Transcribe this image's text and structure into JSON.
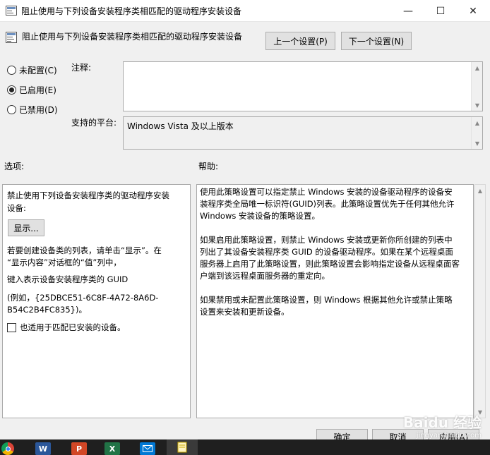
{
  "window": {
    "title": "阻止使用与下列设备安装程序类相匹配的驱动程序安装设备",
    "minimize": "—",
    "maximize": "☐",
    "close": "✕"
  },
  "header": {
    "policy_title": "阻止使用与下列设备安装程序类相匹配的驱动程序安装设备",
    "prev_button": "上一个设置(P)",
    "next_button": "下一个设置(N)"
  },
  "state": {
    "options": [
      {
        "label": "未配置(C)",
        "selected": false
      },
      {
        "label": "已启用(E)",
        "selected": true
      },
      {
        "label": "已禁用(D)",
        "selected": false
      }
    ]
  },
  "comment": {
    "label": "注释:",
    "value": ""
  },
  "platform": {
    "label": "支持的平台:",
    "value": "Windows Vista 及以上版本"
  },
  "options_section": {
    "label": "选项:",
    "line1": "禁止使用下列设备安装程序类的驱动程序安装",
    "line2": "设备:",
    "show_button": "显示...",
    "hint_line1": "若要创建设备类的列表，请单击“显示”。在",
    "hint_line2": "“显示内容”对话框的“值”列中，",
    "key_line": "键入表示设备安装程序类的 GUID",
    "example_line1": "(例如，{25DBCE51-6C8F-4A72-8A6D-",
    "example_line2": "B54C2B4FC835})。",
    "checkbox_label": "也适用于匹配已安装的设备。",
    "checkbox_checked": false
  },
  "help_section": {
    "label": "帮助:",
    "p1_l1": "使用此策略设置可以指定禁止 Windows 安装的设备驱动程序的设备安",
    "p1_l2": "装程序类全局唯一标识符(GUID)列表。此策略设置优先于任何其他允许",
    "p1_l3": "Windows 安装设备的策略设置。",
    "p2_l1": "如果启用此策略设置，则禁止 Windows 安装或更新你所创建的列表中",
    "p2_l2": "列出了其设备安装程序类 GUID 的设备驱动程序。如果在某个远程桌面",
    "p2_l3": "服务器上启用了此策略设置，则此策略设置会影响指定设备从远程桌面客",
    "p2_l4": "户端到该远程桌面服务器的重定向。",
    "p3_l1": "如果禁用或未配置此策略设置，则 Windows 根据其他允许或禁止策略",
    "p3_l2": "设置来安装和更新设备。"
  },
  "footer": {
    "ok_button": "确定",
    "cancel_button": "取消",
    "apply_button": "应用(A)"
  },
  "taskbar": {
    "icons": [
      "chrome-icon",
      "word-icon",
      "powerpoint-icon",
      "excel-icon",
      "outlook-icon",
      "notes-icon"
    ],
    "word_letter": "W",
    "ppt_letter": "P",
    "excel_letter": "X"
  },
  "watermark": {
    "line1": "Baidu 经验",
    "line2": "jingyan.baidu.com"
  },
  "colors": {
    "word": "#2b579a",
    "powerpoint": "#d24726",
    "excel": "#217346",
    "outlook": "#0078d4",
    "chrome": "#db4437"
  }
}
